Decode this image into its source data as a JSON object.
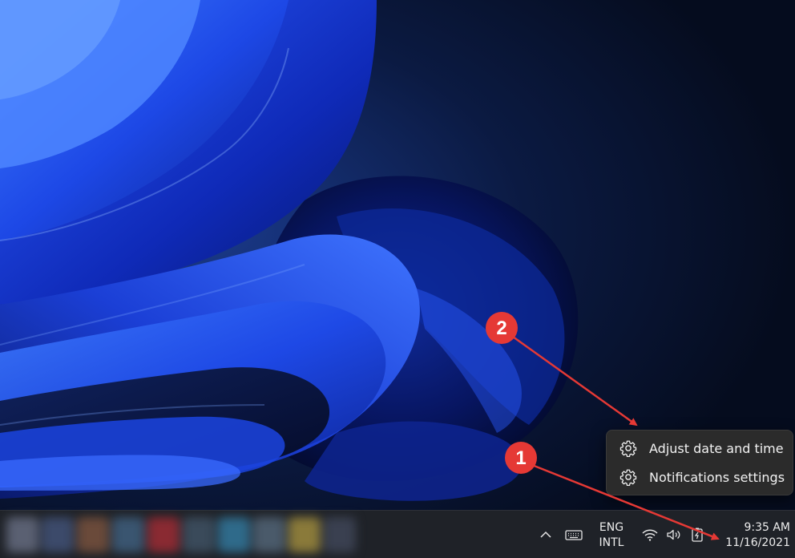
{
  "context_menu": {
    "items": [
      {
        "label": "Adjust date and time",
        "icon": "gear-icon"
      },
      {
        "label": "Notifications settings",
        "icon": "gear-icon"
      }
    ]
  },
  "taskbar": {
    "language": {
      "line1": "ENG",
      "line2": "INTL"
    },
    "clock": {
      "time": "9:35 AM",
      "date": "11/16/2021"
    },
    "tray_icons": [
      "chevron-up-icon",
      "keyboard-icon",
      "wifi-icon",
      "volume-icon",
      "battery-icon"
    ]
  },
  "annotations": {
    "callout_1": "1",
    "callout_2": "2",
    "color": "#e53935"
  },
  "colors": {
    "menu_background": "#2b2b2b",
    "taskbar_background": "#1f2228",
    "wallpaper_accent": "#1f4fff"
  }
}
